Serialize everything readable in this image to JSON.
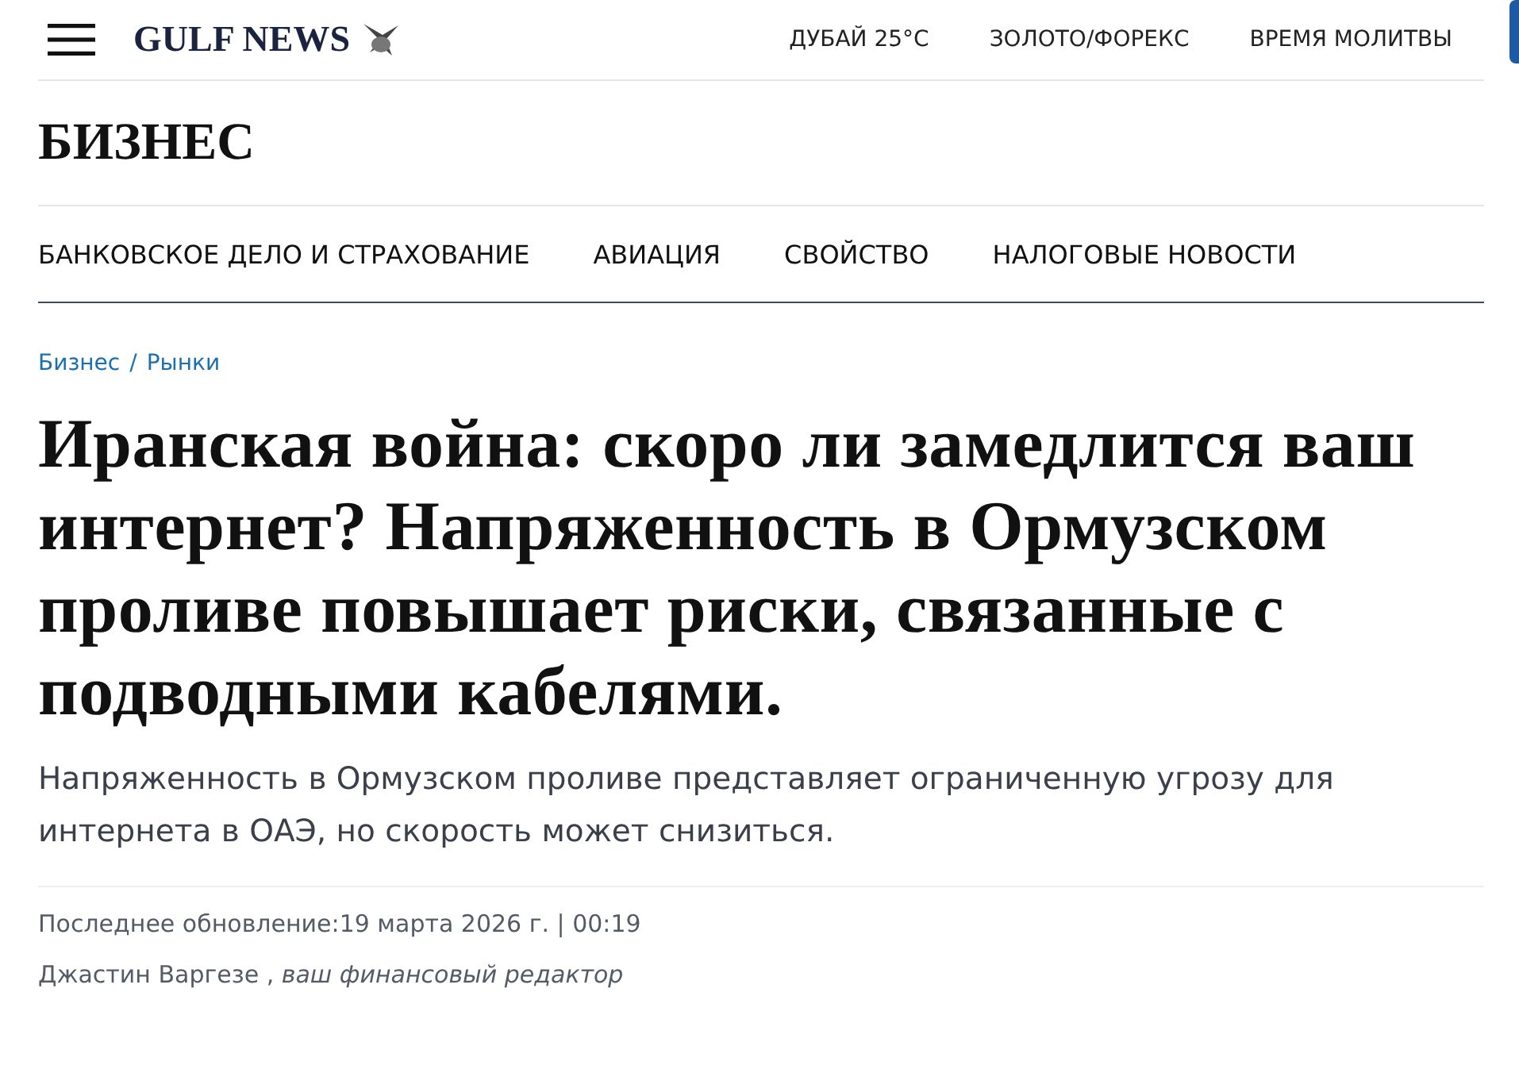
{
  "header": {
    "logo": "GULF NEWS",
    "links": [
      "ДУБАЙ 25°C",
      "ЗОЛОТО/ФОРЕКС",
      "ВРЕМЯ МОЛИТВЫ"
    ]
  },
  "section": {
    "title": "БИЗНЕС",
    "nav": [
      "БАНКОВСКОЕ ДЕЛО И СТРАХОВАНИЕ",
      "АВИАЦИЯ",
      "СВОЙСТВО",
      "НАЛОГОВЫЕ НОВОСТИ"
    ]
  },
  "breadcrumb": [
    "Бизнес",
    "Рынки"
  ],
  "breadcrumb_separator": "/",
  "article": {
    "headline": "Иранская война: скоро ли замедлится ваш интернет? Напряженность в Ормузском проливе повышает риски, связанные с подводными кабелями.",
    "summary": "Напряженность в Ормузском проливе представляет ограниченную угрозу для интернета в ОАЭ, но скорость может снизиться.",
    "updated": "Последнее обновление:19 марта 2026 г. | 00:19",
    "byline": "Джастин Варгезе , *ваш финансовый редактор*"
  }
}
